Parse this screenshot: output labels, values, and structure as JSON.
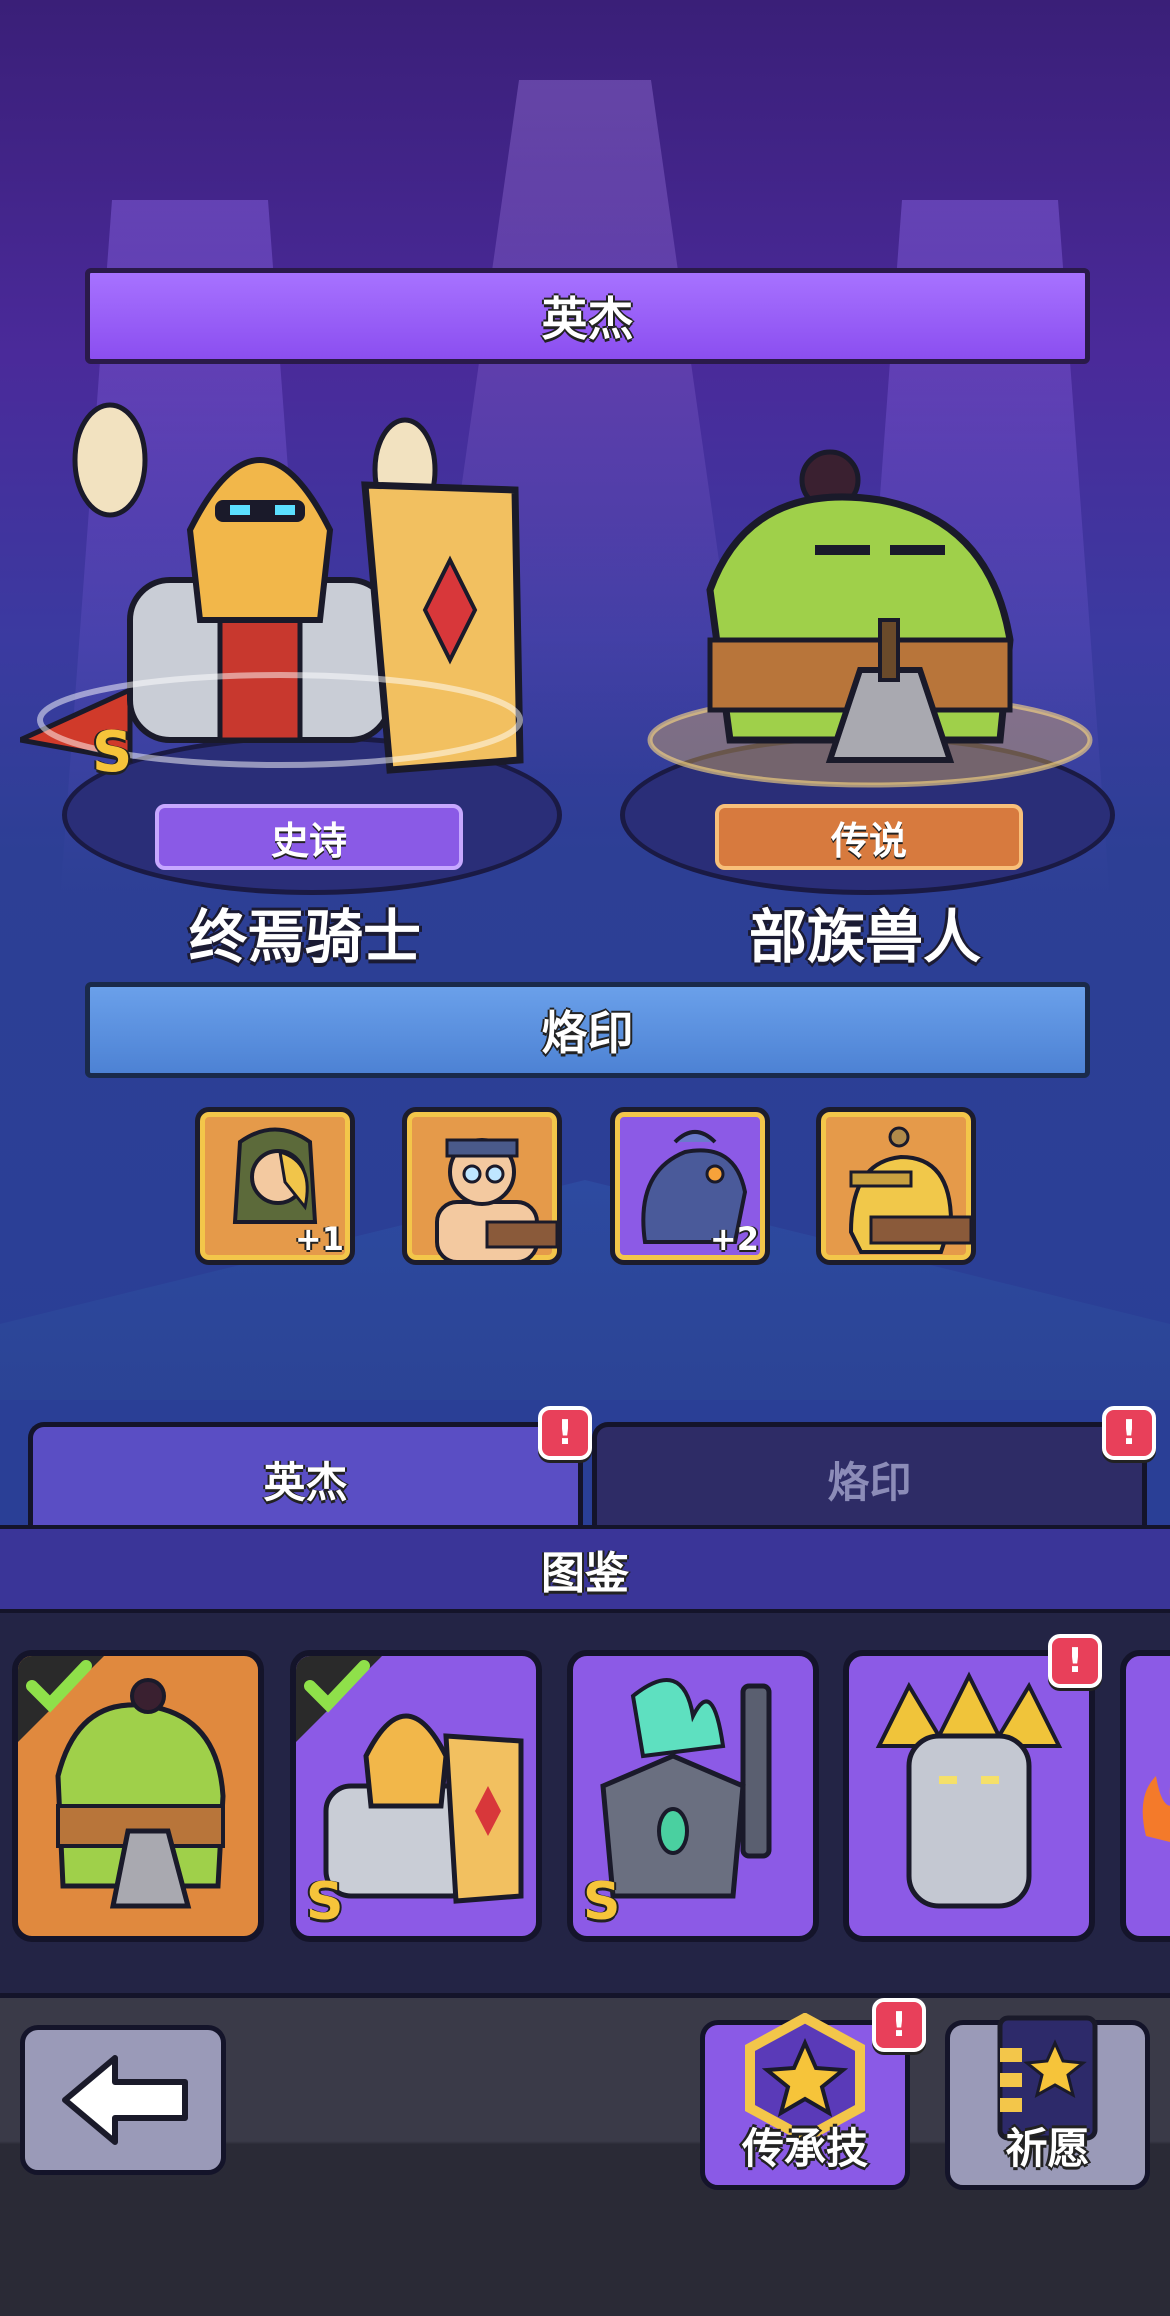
{
  "banners": {
    "heroes_title": "英杰",
    "brands_title": "烙印",
    "codex_title": "图鉴"
  },
  "heroes": [
    {
      "name": "终焉骑士",
      "rarity": "史诗",
      "grade": "S",
      "rarity_color": "#8a5ae6"
    },
    {
      "name": "部族兽人",
      "rarity": "传说",
      "grade": "",
      "rarity_color": "#d77a3e"
    }
  ],
  "brands": [
    {
      "icon": "hooded-archer-icon",
      "bonus": "+1",
      "frame": "orange"
    },
    {
      "icon": "bearded-brawler-icon",
      "bonus": "",
      "frame": "orange"
    },
    {
      "icon": "fish-man-icon",
      "bonus": "+2",
      "frame": "purple"
    },
    {
      "icon": "duck-warrior-icon",
      "bonus": "",
      "frame": "orange"
    }
  ],
  "tabs": [
    {
      "label": "英杰",
      "active": true,
      "alert": "!"
    },
    {
      "label": "烙印",
      "active": false,
      "alert": "!"
    }
  ],
  "codex": [
    {
      "icon": "tribal-orc-icon",
      "grade": "",
      "owned": true,
      "frame": "orange"
    },
    {
      "icon": "doom-knight-icon",
      "grade": "S",
      "owned": true,
      "frame": "purple"
    },
    {
      "icon": "ghost-knight-icon",
      "grade": "S",
      "owned": false,
      "frame": "purple"
    },
    {
      "icon": "stone-golem-icon",
      "grade": "",
      "owned": false,
      "frame": "purple",
      "alert": "!"
    }
  ],
  "bottom_bar": {
    "back_icon": "back-arrow-icon",
    "legacy_label": "传承技",
    "legacy_alert": "!",
    "wish_label": "祈愿"
  }
}
